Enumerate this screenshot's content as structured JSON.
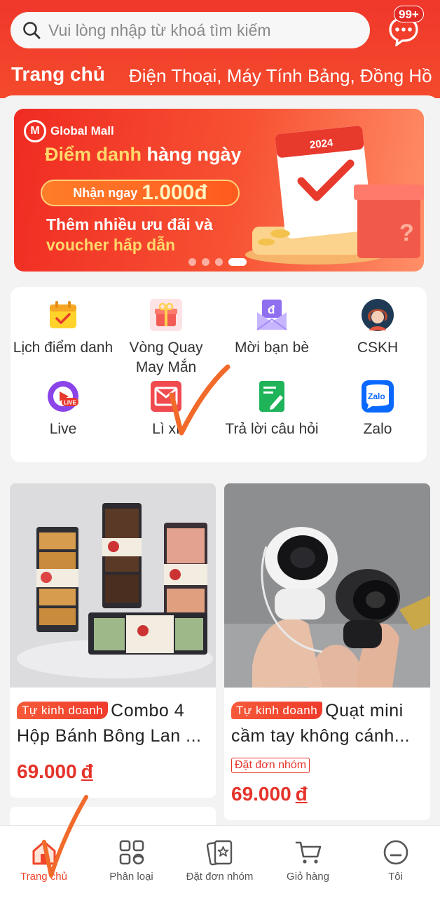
{
  "search": {
    "placeholder": "Vui lòng nhập từ khoá tìm kiếm"
  },
  "chat": {
    "badge": "99+",
    "icon": "chat-bubble-icon"
  },
  "categories": {
    "active": "Trang chủ",
    "rest": "Điện Thoại, Máy Tính Bảng, Đồng Hồ"
  },
  "banner": {
    "brand": "Global Mall",
    "title_a": "Điểm danh",
    "title_b": " hàng ngày",
    "pill_a": "Nhận ngay",
    "pill_b": "1.000đ",
    "sub1": "Thêm nhiều ưu đãi và",
    "sub2": "voucher hấp dẫn",
    "year": "2024",
    "slides": 4,
    "active_slide": 4
  },
  "quick_menu": [
    {
      "label": "Lịch điểm danh",
      "icon": "calendar-check-icon"
    },
    {
      "label": "Vòng Quay May Mắn",
      "icon": "gift-box-icon"
    },
    {
      "label": "Mời bạn bè",
      "icon": "invite-envelope-icon"
    },
    {
      "label": "CSKH",
      "icon": "support-agent-icon"
    },
    {
      "label": "Live",
      "icon": "live-icon"
    },
    {
      "label": "Lì xì",
      "icon": "red-envelope-icon"
    },
    {
      "label": "Trả lời câu hỏi",
      "icon": "quiz-icon"
    },
    {
      "label": "Zalo",
      "icon": "zalo-icon"
    }
  ],
  "products": [
    {
      "tag": "Tự kinh doanh",
      "title_1": "Combo 4",
      "title_2": "Hộp Bánh Bông Lan ...",
      "price": "69.000",
      "currency": "đ",
      "group": ""
    },
    {
      "tag": "Tự kinh doanh",
      "title_1": "Quạt mini",
      "title_2": "cầm tay không cánh...",
      "price": "69.000",
      "currency": "đ",
      "group": "Đặt đơn nhóm"
    }
  ],
  "bottom_nav": [
    {
      "label": "Trang chủ",
      "icon": "home-icon",
      "active": true
    },
    {
      "label": "Phân loại",
      "icon": "category-grid-icon"
    },
    {
      "label": "Đặt đơn nhóm",
      "icon": "group-order-icon"
    },
    {
      "label": "Giỏ hàng",
      "icon": "cart-icon"
    },
    {
      "label": "Tôi",
      "icon": "profile-icon"
    }
  ],
  "colors": {
    "primary": "#f0372b",
    "price": "#e5332a",
    "annotation": "#f26a2a"
  }
}
